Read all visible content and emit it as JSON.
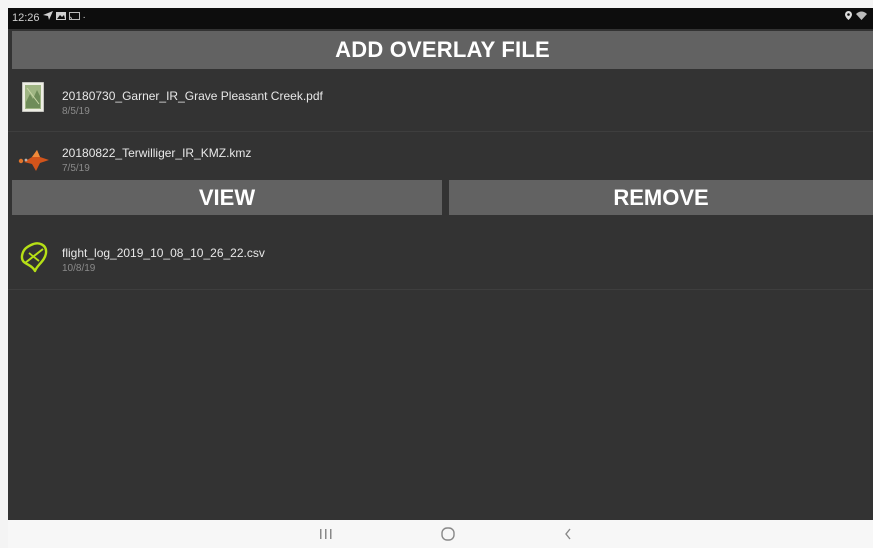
{
  "status_bar": {
    "time": "12:26",
    "icons": [
      "navigation-arrow-icon",
      "gallery-icon",
      "cast-icon",
      "dot-icon",
      "location-icon",
      "wifi-icon"
    ]
  },
  "header": {
    "add_button_label": "ADD OVERLAY FILE"
  },
  "files": [
    {
      "name": "20180730_Garner_IR_Grave Pleasant Creek.pdf",
      "date": "8/5/19",
      "icon": "pdf-map-thumbnail-icon"
    },
    {
      "name": "20180822_Terwilliger_IR_KMZ.kmz",
      "date": "7/5/19",
      "icon": "kmz-overlay-icon"
    },
    {
      "name": "flight_log_2019_10_08_10_26_22.csv",
      "date": "10/8/19",
      "icon": "flight-log-icon"
    }
  ],
  "actions": {
    "view_label": "VIEW",
    "remove_label": "REMOVE"
  },
  "colors": {
    "background": "#333333",
    "button": "#626262",
    "status_bar": "#0d0d0d",
    "flight_log_icon": "#b6e016",
    "kmz_icon": "#e05a1c"
  },
  "navbar": {
    "icons": [
      "recent-apps-icon",
      "home-icon",
      "back-icon"
    ]
  }
}
